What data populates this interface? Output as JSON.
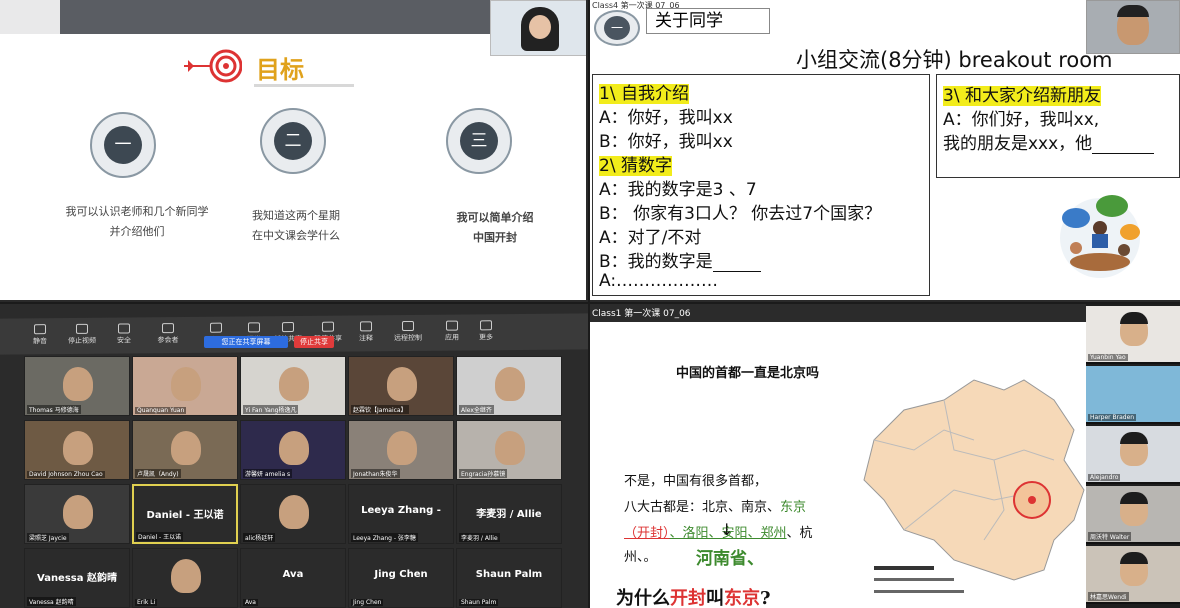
{
  "q1": {
    "goal": "目标",
    "captions": [
      {
        "numeral": "一",
        "text1": "我可以认识老师和几个新同学",
        "text2": "并介绍他们"
      },
      {
        "numeral": "二",
        "text1": "我知道这两个星期",
        "text2": "在中文课会学什么"
      },
      {
        "numeral": "三",
        "text1": "我可以简单介绍",
        "text2": "中国开封"
      }
    ]
  },
  "q2": {
    "window_title": "Class4 第一次课 07_06",
    "medal": "一",
    "tab_title": "关于同学",
    "heading": "小组交流(8分钟) breakout room",
    "box1": {
      "h1": "1\\ 自我介绍",
      "l1": "A：你好，我叫xx",
      "l2": "B：你好，我叫xx",
      "h2": "2\\ 猜数字",
      "l3": "A：我的数字是3 、7",
      "l4": "B：  你家有3口人？ 你去过7个国家？",
      "l5": "A：对了/不对",
      "l6": "B：我的数字是",
      "l7": "A:………………"
    },
    "box2": {
      "h": "3\\ 和大家介绍新朋友",
      "l1": "A：你们好，我叫xx,",
      "l2": "我的朋友是xxx，他"
    }
  },
  "q3": {
    "toolbar": [
      {
        "label": "静音",
        "icon": "mic-icon"
      },
      {
        "label": "停止视频",
        "icon": "video-icon"
      },
      {
        "label": "安全",
        "icon": "shield-icon"
      },
      {
        "label": "参会者",
        "icon": "participants-icon"
      },
      {
        "label": "聊天",
        "icon": "chat-icon"
      },
      {
        "label": "问卷",
        "icon": "poll-icon"
      },
      {
        "label": "新的共享",
        "icon": "share-icon"
      },
      {
        "label": "暂停共享",
        "icon": "pause-icon"
      },
      {
        "label": "注释",
        "icon": "annotate-icon"
      },
      {
        "label": "远程控制",
        "icon": "remote-icon"
      },
      {
        "label": "应用",
        "icon": "apps-icon"
      },
      {
        "label": "更多",
        "icon": "more-icon"
      }
    ],
    "sharing_label": "您正在共享屏幕",
    "stop_share": "停止共享",
    "tiles": [
      {
        "name": "Thomas 马修德海",
        "big": "",
        "bg": "#6b6a63"
      },
      {
        "name": "Quanquan Yuan",
        "big": "",
        "bg": "#c9a894"
      },
      {
        "name": "Yi Fan Yang杨逸凡",
        "big": "",
        "bg": "#d6d4cf"
      },
      {
        "name": "赵霖钦【Jamaica】",
        "big": "",
        "bg": "#5a4638"
      },
      {
        "name": "Alex全继齐",
        "big": "",
        "bg": "#cfcfcf"
      },
      {
        "name": "David Johnson Zhou Cao",
        "big": "",
        "bg": "#6e5a44"
      },
      {
        "name": "卢晟凯（Andy)",
        "big": "",
        "bg": "#7a6a55"
      },
      {
        "name": "游馨妍 amelia s",
        "big": "",
        "bg": "#2e2a4c"
      },
      {
        "name": "Jonathan朱俊华",
        "big": "",
        "bg": "#8a8178"
      },
      {
        "name": "Engracia孙慕镜",
        "big": "",
        "bg": "#b7b2ac"
      },
      {
        "name": "梁照芝 Jaycie",
        "big": "",
        "bg": "#3a3a3a"
      },
      {
        "name": "Daniel - 王以诺",
        "big": "Daniel - 王以诺",
        "bg": "#2b2b2b"
      },
      {
        "name": "alic杨廷轩",
        "big": "",
        "bg": "#2b2b2b"
      },
      {
        "name": "Leeya Zhang - 张李糖",
        "big": "Leeya Zhang -",
        "bg": "#2b2b2b"
      },
      {
        "name": "李麦羽 / Allie",
        "big": "李麦羽 / Allie",
        "bg": "#2b2b2b"
      },
      {
        "name": "Vanessa 赵韵晴",
        "big": "Vanessa 赵韵晴",
        "bg": "#2b2b2b"
      },
      {
        "name": "Erik Li",
        "big": "",
        "bg": "#2b2b2b"
      },
      {
        "name": "Ava",
        "big": "Ava",
        "bg": "#2b2b2b"
      },
      {
        "name": "Jing Chen",
        "big": "Jing Chen",
        "bg": "#2b2b2b"
      },
      {
        "name": "Shaun Palm",
        "big": "Shaun Palm",
        "bg": "#2b2b2b"
      }
    ]
  },
  "q4": {
    "window_title": "Class1 第一次课 07_06",
    "question": "中国的首都一直是北京吗",
    "l1": "不是，中国有很多首都，",
    "l2a": "八大古都是：北京、南京、",
    "l2b": "东京",
    "l3a": "（开封）",
    "l3b": "、洛阳、安阳、郑州",
    "l3c": "、杭",
    "l4": "州、。",
    "arrow": "↓",
    "henan": "河南省、",
    "why_a": "为什么",
    "why_b": "开封",
    "why_c": "叫",
    "why_d": "东京",
    "why_e": "?",
    "side": [
      {
        "name": "Yuanbin Yao"
      },
      {
        "name": "Harper Braden"
      },
      {
        "name": "Alejandro"
      },
      {
        "name": "周沃特 Walter"
      },
      {
        "name": "林嘉思Wendi"
      }
    ]
  }
}
